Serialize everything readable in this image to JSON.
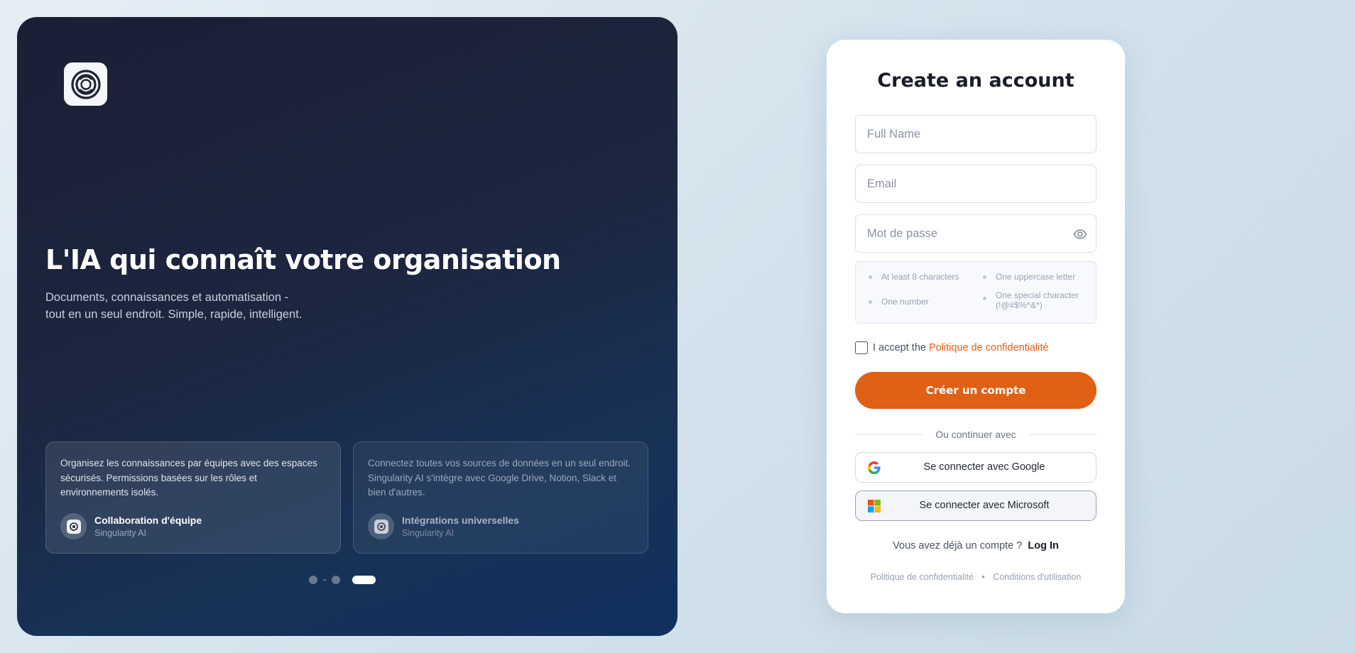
{
  "hero": {
    "title": "L'IA qui connaît votre organisation",
    "subtitle_line1": "Documents, connaissances et automatisation -",
    "subtitle_line2": "tout en un seul endroit. Simple, rapide, intelligent.",
    "logo_icon": "swirl-logo-icon",
    "cards": [
      {
        "text": "Organisez les connaissances par équipes avec des espaces sécurisés. Permissions basées sur les rôles et environnements isolés.",
        "name": "Collaboration d'équipe",
        "role": "Singularity AI"
      },
      {
        "text": "Connectez toutes vos sources de données en un seul endroit. Singularity AI s'intègre avec Google Drive, Notion, Slack et bien d'autres.",
        "name": "Intégrations universelles",
        "role": "Singularity AI"
      }
    ],
    "carousel": {
      "total": 3,
      "active_index": 2
    }
  },
  "form": {
    "title": "Create an account",
    "full_name_placeholder": "Full Name",
    "email_placeholder": "Email",
    "password_placeholder": "Mot de passe",
    "requirements": {
      "min_length": "At least 8 characters",
      "uppercase": "One uppercase letter",
      "number": "One number",
      "special_line1": "One special character",
      "special_line2": "(!@#$%^&*)"
    },
    "accept_text": "I accept the",
    "accept_link": "Politique de confidentialité",
    "submit_label": "Créer un compte",
    "divider_label": "Ou continuer avec",
    "google_label": "Se connecter avec Google",
    "microsoft_label": "Se connecter avec Microsoft",
    "have_account_text": "Vous avez déjà un compte ?",
    "login_link": "Log In",
    "privacy_link": "Politique de confidentialité",
    "terms_link": "Conditions d'utilisation"
  },
  "colors": {
    "accent": "#e06014",
    "hero_bg_start": "#1b1f35",
    "hero_bg_end": "#11305e"
  }
}
